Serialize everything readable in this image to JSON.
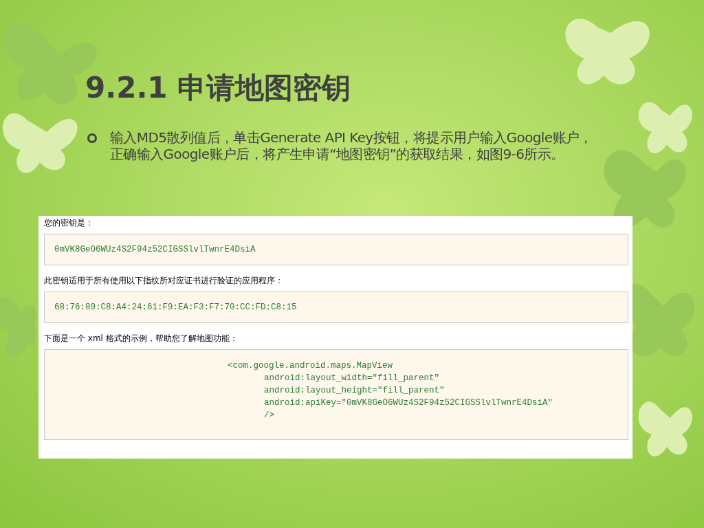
{
  "slide": {
    "title": "9.2.1 申请地图密钥",
    "bullets": [
      "输入MD5散列值后，单击Generate API Key按钮，将提示用户输入Google账户，正确输入Google账户后，将产生申请“地图密钥”的获取结果，如图9-6所示。"
    ]
  },
  "screenshot": {
    "sections": [
      {
        "label": "您的密钥是：",
        "kind": "inline",
        "code": {
          "text": "0mVK8GeO6WUz4S2F94z52CIGSSlvlTwnrE4DsiA"
        }
      },
      {
        "label": "此密钥适用于所有使用以下指纹所对应证书进行验证的应用程序：",
        "kind": "inline",
        "code": {
          "text": "68:76:89:C8:A4:24:61:F9:EA:F3:F7:70:CC:FD:C8:15"
        }
      },
      {
        "label": "下面是一个 xml 格式的示例，帮助您了解地图功能：",
        "kind": "block",
        "code": {
          "text": "<com.google.android.maps.MapView",
          "children": [
            {
              "text": "android:layout_width=\"fill_parent\""
            },
            {
              "text": "android:layout_height=\"fill_parent\""
            },
            {
              "text": "android:apiKey=\"0mVK8GeO6WUz4S2F94z52CIGSSlvlTwnrE4DsiA\""
            },
            {
              "text": "/>"
            }
          ]
        }
      }
    ]
  }
}
